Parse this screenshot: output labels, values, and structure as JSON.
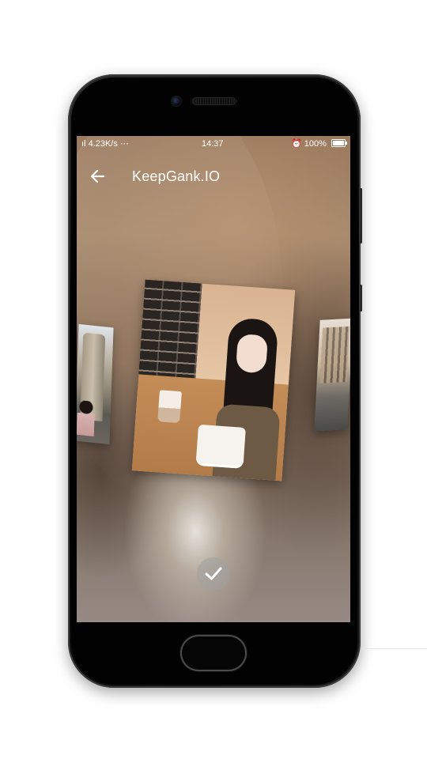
{
  "status_bar": {
    "left_text": "4.23K/s ⋯",
    "time": "14:37",
    "battery": "100%"
  },
  "app_bar": {
    "title": "KeepGank.IO",
    "back_icon": "arrow-left-icon"
  },
  "confirm": {
    "icon": "check-icon"
  },
  "colors": {
    "status_text": "#ffffff",
    "title_text": "#ffffff",
    "phone_body": "#000000"
  }
}
